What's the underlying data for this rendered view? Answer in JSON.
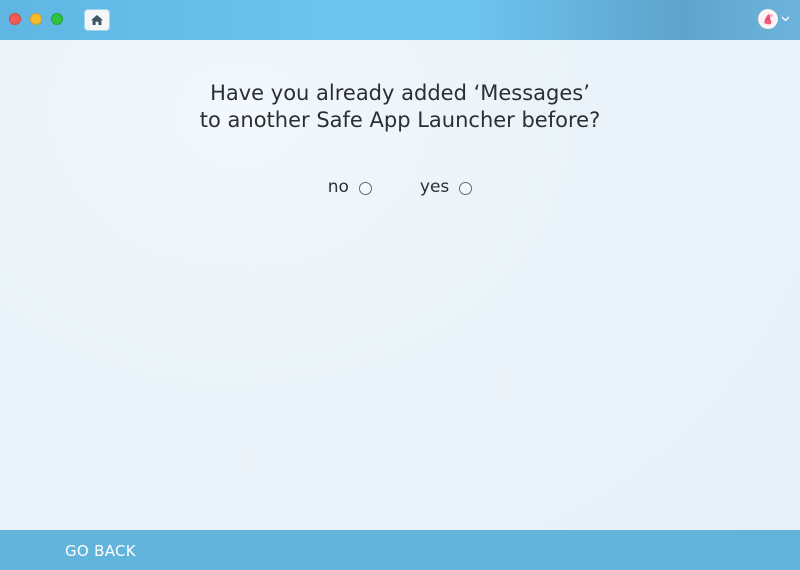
{
  "titlebar": {
    "controls": [
      "close",
      "minimize",
      "zoom"
    ],
    "home_icon": "home-icon",
    "account_icon": "avatar",
    "dropdown_icon": "chevron-down-icon"
  },
  "question": {
    "line1": "Have you already added ‘Messages’",
    "line2": "to another Safe App Launcher before?"
  },
  "options": [
    {
      "label": "no",
      "selected": false
    },
    {
      "label": "yes",
      "selected": false
    }
  ],
  "footer": {
    "go_back_label": "GO BACK"
  },
  "colors": {
    "titlebar": "#6cc3ee",
    "footer": "#63b4dc",
    "background": "#eaf3f9",
    "text": "#2b2f33"
  }
}
